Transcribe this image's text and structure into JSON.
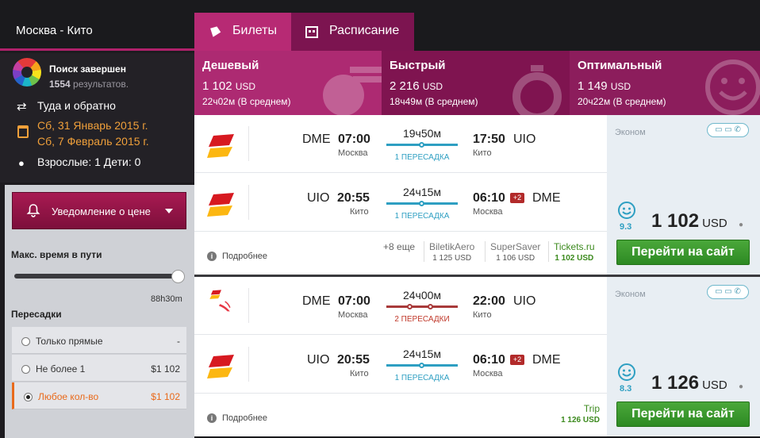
{
  "route": "Москва - Кито",
  "search": {
    "status": "Поиск завершен",
    "count": "1554",
    "count_suffix": "результатов.",
    "trip_type": "Туда и обратно",
    "date_out": "Сб, 31 Январь 2015 г.",
    "date_back": "Сб, 7 Февраль 2015 г.",
    "passengers": "Взрослые: 1 Дети: 0"
  },
  "filters": {
    "notify_label": "Уведомление о цене",
    "max_time_title": "Макс. время в пути",
    "max_time_value": "88h30m",
    "max_time_fraction": 1.0,
    "stops_title": "Пересадки",
    "stops": [
      {
        "label": "Только прямые",
        "price": "-"
      },
      {
        "label": "Не более 1",
        "price": "$1 102"
      },
      {
        "label": "Любое кол-во",
        "price": "$1 102"
      }
    ]
  },
  "tabs": [
    {
      "label": "Билеты"
    },
    {
      "label": "Расписание"
    }
  ],
  "summary": [
    {
      "title": "Дешевый",
      "price": "1 102",
      "currency": "USD",
      "duration": "22ч02м (В среднем)"
    },
    {
      "title": "Быстрый",
      "price": "2 216",
      "currency": "USD",
      "duration": "18ч49м (В среднем)"
    },
    {
      "title": "Оптимальный",
      "price": "1 149",
      "currency": "USD",
      "duration": "20ч22м (В среднем)"
    }
  ],
  "results": [
    {
      "legs": [
        {
          "from_code": "DME",
          "dep_time": "07:00",
          "from_city": "Москва",
          "duration": "19ч50м",
          "stops": "1 ПЕРЕСАДКА",
          "arr_time": "17:50",
          "to_code": "UIO",
          "to_city": "Кито",
          "day_offset": ""
        },
        {
          "from_code": "UIO",
          "dep_time": "20:55",
          "from_city": "Кито",
          "duration": "24ч15м",
          "stops": "1 ПЕРЕСАДКА",
          "arr_time": "06:10",
          "to_code": "DME",
          "to_city": "Москва",
          "day_offset": "+2"
        }
      ],
      "details": "Подробнее",
      "more": "+8 еще",
      "agents": [
        {
          "name": "BiletikAero",
          "price": "1 125 USD"
        },
        {
          "name": "SuperSaver",
          "price": "1 106 USD"
        },
        {
          "name": "Tickets.ru",
          "price": "1 102 USD"
        }
      ],
      "cabin": "Эконом",
      "rating": "9.3",
      "price": "1 102",
      "currency": "USD",
      "button": "Перейти на сайт"
    },
    {
      "legs": [
        {
          "from_code": "DME",
          "dep_time": "07:00",
          "from_city": "Москва",
          "duration": "24ч00м",
          "stops": "2 ПЕРЕСАДКИ",
          "arr_time": "22:00",
          "to_code": "UIO",
          "to_city": "Кито",
          "day_offset": ""
        },
        {
          "from_code": "UIO",
          "dep_time": "20:55",
          "from_city": "Кито",
          "duration": "24ч15м",
          "stops": "1 ПЕРЕСАДКА",
          "arr_time": "06:10",
          "to_code": "DME",
          "to_city": "Москва",
          "day_offset": "+2"
        }
      ],
      "details": "Подробнее",
      "agents": [
        {
          "name": "Trip",
          "price": "1 126 USD"
        }
      ],
      "cabin": "Эконом",
      "rating": "8.3",
      "price": "1 126",
      "currency": "USD",
      "button": "Перейти на сайт"
    }
  ],
  "colors": {
    "accent": "#b72a74",
    "dark_accent": "#7f1450",
    "go_green": "#3c9a2e",
    "stops_orange": "#e96a1b",
    "leg_blue": "#2e9fc2",
    "leg_red": "#a83a3a"
  }
}
